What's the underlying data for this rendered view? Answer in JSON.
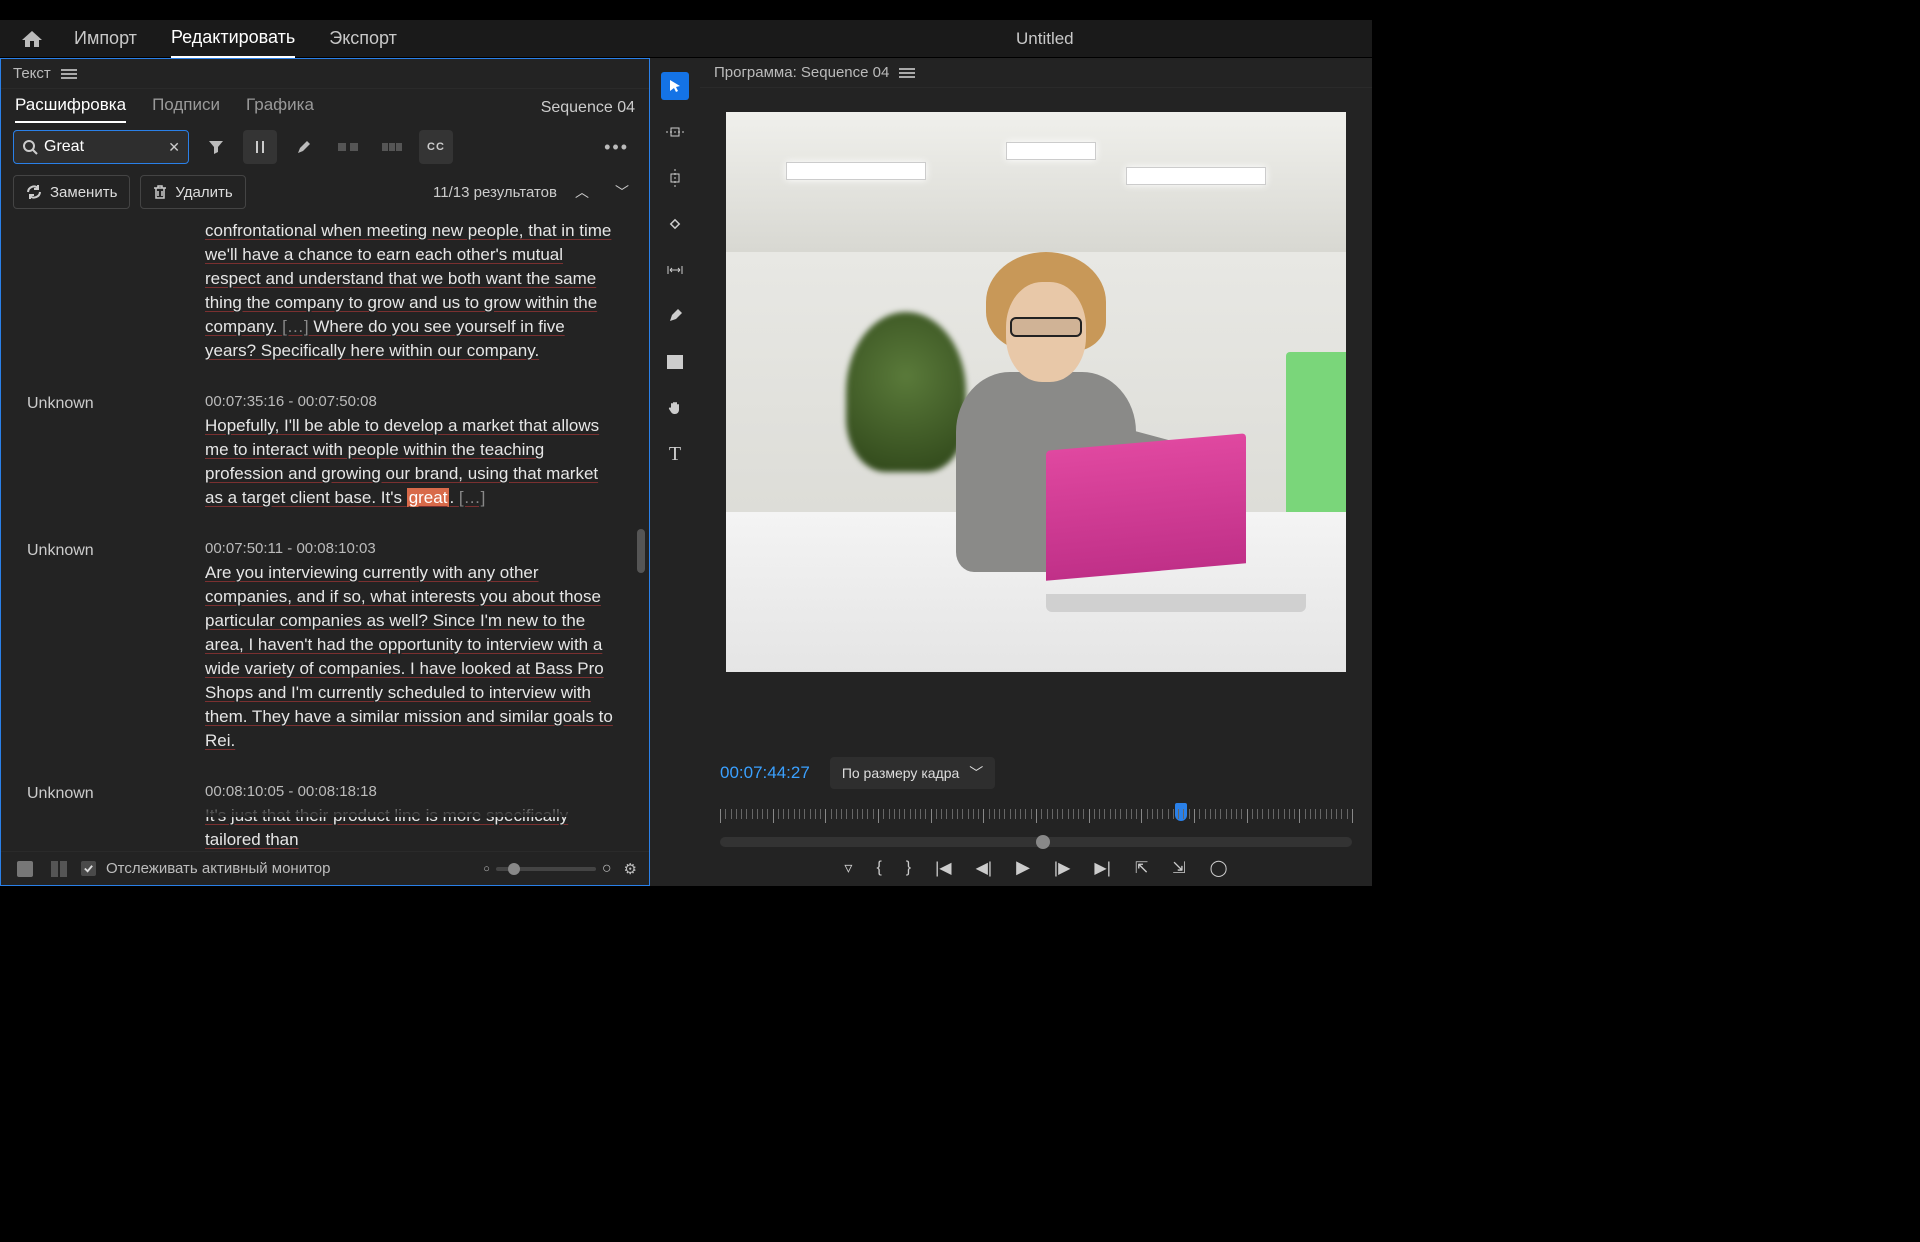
{
  "nav": {
    "import": "Импорт",
    "edit": "Редактировать",
    "export": "Экспорт",
    "title": "Untitled"
  },
  "textPanel": {
    "title": "Текст",
    "tabs": {
      "transcript": "Расшифровка",
      "captions": "Подписи",
      "graphics": "Графика"
    },
    "sequence": "Sequence 04",
    "searchValue": "Great",
    "replace": "Заменить",
    "delete": "Удалить",
    "resultCount": "11/13 результатов",
    "trackMonitor": "Отслеживать активный монитор"
  },
  "segments": [
    {
      "speaker": "",
      "time": "",
      "text": "confrontational when meeting new people, that in time we'll have a chance to earn each other's mutual respect and understand that we both want the same thing the company to grow and us to grow within the company. […] Where do you see yourself in five years? Specifically here within our company."
    },
    {
      "speaker": "Unknown",
      "time": "00:07:35:16 - 00:07:50:08",
      "text": "Hopefully, I'll be able to develop a market that allows me to interact with people within the teaching profession and growing our brand, using that market as a target client base. It's |great|. […]"
    },
    {
      "speaker": "Unknown",
      "time": "00:07:50:11 - 00:08:10:03",
      "text": "Are you interviewing currently with any other companies, and if so, what interests you about those particular companies as well? Since I'm new to the area, I haven't had the opportunity to interview with a wide variety of companies. I have looked at Bass Pro Shops and I'm currently scheduled to interview with them. They have a similar mission and similar goals to Rei."
    },
    {
      "speaker": "Unknown",
      "time": "00:08:10:05 - 00:08:18:18",
      "text": "It's just that their product line is more specifically tailored than"
    }
  ],
  "program": {
    "title": "Программа: Sequence 04",
    "timecode": "00:07:44:27",
    "fit": "По размеру кадра"
  }
}
